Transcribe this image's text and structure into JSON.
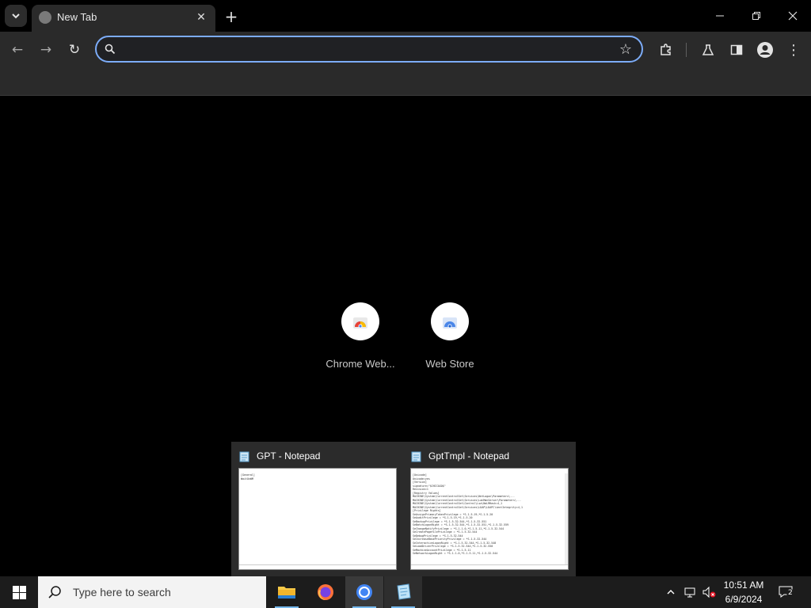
{
  "browser": {
    "tab": {
      "title": "New Tab"
    },
    "omnibox": {
      "value": "",
      "placeholder": ""
    },
    "shortcuts": [
      {
        "label": "Chrome Web..."
      },
      {
        "label": "Web Store"
      }
    ]
  },
  "taskbar_preview": {
    "windows": [
      {
        "title": "GPT - Notepad",
        "content": "[General]\nWaitOnWM"
      },
      {
        "title": "GptTmpl - Notepad",
        "content": "[Unicode]\nUnicode=yes\n[Version]\nsignature=\"$CHICAGO$\"\nRevision=1\n[Registry Values]\nMACHINE\\System\\CurrentControlSet\\Services\\NetLogon\\Parameters\\...\nMACHINE\\System\\CurrentControlSet\\Services\\LanManServer\\Parameters\\...\nMACHINE\\System\\CurrentControlSet\\Control\\Lsa\\NoLMHash=4,1\nMACHINE\\System\\CurrentControlSet\\Services\\LDAP\\LDAPClientIntegrity=4,1\n[Privilege Rights]\nSeAssignPrimaryTokenPrivilege = *S-1-5-19,*S-1-5-20\nSeAuditPrivilege = *S-1-5-19,*S-1-5-20\nSeBackupPrivilege = *S-1-5-32-544,*S-1-5-32-551\nSeBatchLogonRight = *S-1-5-32-544,*S-1-5-32-551,*S-1-5-32-559\nSeChangeNotifyPrivilege = *S-1-1-0,*S-1-5-11,*S-1-5-32-544\nSeCreatePagefilePrivilege = *S-1-5-32-544\nSeDebugPrivilege = *S-1-5-32-544\nSeIncreaseBasePriorityPrivilege = *S-1-5-32-544\nSeInteractiveLogonRight = *S-1-5-32-544,*S-1-5-32-548\nSeLoadDriverPrivilege = *S-1-5-32-544,*S-1-5-32-550\nSeMachineAccountPrivilege = *S-1-5-11\nSeNetworkLogonRight = *S-1-1-0,*S-1-5-11,*S-1-5-32-544"
      }
    ]
  },
  "taskbar": {
    "search_placeholder": "Type here to search",
    "clock_time": "10:51 AM",
    "clock_date": "6/9/2024",
    "notification_count": "2"
  },
  "colors": {
    "accent": "#7cacf8",
    "taskbar": "#1c1c1c",
    "toolbar": "#2a2a2a"
  }
}
